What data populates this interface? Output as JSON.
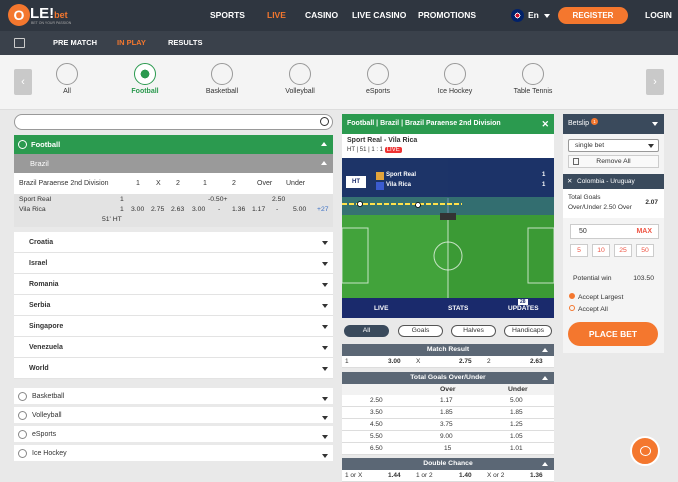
{
  "brand": {
    "logo_o": "O",
    "logo_le": "LE!",
    "logo_bet": "bet",
    "tagline": "BET ON YOUR PASSION"
  },
  "topnav": {
    "sports": "SPORTS",
    "live": "LIVE",
    "casino": "CASINO",
    "live_casino": "LIVE CASINO",
    "promotions": "PROMOTIONS",
    "lang": "En",
    "register": "REGISTER",
    "login": "LOGIN"
  },
  "subnav": {
    "prematch": "PRE MATCH",
    "inplay": "IN PLAY",
    "results": "RESULTS"
  },
  "sports": [
    {
      "label": "All"
    },
    {
      "label": "Football"
    },
    {
      "label": "Basketball"
    },
    {
      "label": "Volleyball"
    },
    {
      "label": "eSports"
    },
    {
      "label": "Ice Hockey"
    },
    {
      "label": "Table Tennis"
    }
  ],
  "left": {
    "football": "Football",
    "brazil": "Brazil",
    "league": {
      "name": "Brazil Paraense 2nd Division",
      "h1": "1",
      "hx": "X",
      "h2": "2",
      "h4": "1",
      "h5": "2",
      "h6": "Over",
      "h7": "Under"
    },
    "match": {
      "team1": "Sport Real",
      "team2": "Vila Rica",
      "score1": "1",
      "score2": "1",
      "hc": "-0.50+",
      "ou": "2.50",
      "o1": "3.00",
      "ox": "2.75",
      "o2": "2.63",
      "a1": "3.00",
      "a2": "-",
      "a3": "1.36",
      "u1": "1.17",
      "u2": "-",
      "u3": "5.00",
      "more": "+27",
      "time": "51' HT"
    },
    "countries": [
      "Croatia",
      "Israel",
      "Romania",
      "Serbia",
      "Singapore",
      "Venezuela",
      "World"
    ],
    "sport_rows": [
      "Basketball",
      "Volleyball",
      "eSports",
      "Ice Hockey"
    ]
  },
  "mid": {
    "header": "Football | Brazil | Brazil Paraense 2nd Division",
    "teams": "Sport Real - Vila Rica",
    "status": "HT | 51 | 1 : 1",
    "live_badge": "LIVE",
    "tracker": {
      "ht": "HT",
      "t1": "Sport Real",
      "t2": "Vila Rica",
      "s1": "1",
      "s2": "1"
    },
    "tabs": {
      "live": "LIVE",
      "stats": "STATS",
      "updates": "UPDATES",
      "count": "28"
    },
    "filters": [
      "All",
      "Goals",
      "Halves",
      "Handicaps"
    ],
    "match_result": {
      "title": "Match Result",
      "l1": "1",
      "v1": "3.00",
      "lx": "X",
      "vx": "2.75",
      "l2": "2",
      "v2": "2.63"
    },
    "ou": {
      "title": "Total Goals Over/Under",
      "over": "Over",
      "under": "Under",
      "rows": [
        [
          "2.50",
          "1.17",
          "5.00"
        ],
        [
          "3.50",
          "1.85",
          "1.85"
        ],
        [
          "4.50",
          "3.75",
          "1.25"
        ],
        [
          "5.50",
          "9.00",
          "1.05"
        ],
        [
          "6.50",
          "15",
          "1.01"
        ]
      ]
    },
    "dc": {
      "title": "Double Chance",
      "l1": "1 or X",
      "v1": "1.44",
      "l2": "1 or 2",
      "v2": "1.40",
      "l3": "X or 2",
      "v3": "1.36"
    }
  },
  "betslip": {
    "title": "Betslip",
    "count": "1",
    "mode": "single bet",
    "remove": "Remove All",
    "match": "Colombia - Uruguay",
    "market": "Total Goals",
    "pick": "Over/Under 2.50 Over",
    "odds": "2.07",
    "stake": "50",
    "max": "MAX",
    "chips": [
      "5",
      "10",
      "25",
      "50"
    ],
    "pw_label": "Potential win",
    "pw": "103.50",
    "accept_largest": "Accept Largest",
    "accept_all": "Accept All",
    "place": "PLACE BET"
  },
  "colors": {
    "accent": "#f4772e",
    "green": "#2b9a4f",
    "dark": "#2f3640"
  }
}
